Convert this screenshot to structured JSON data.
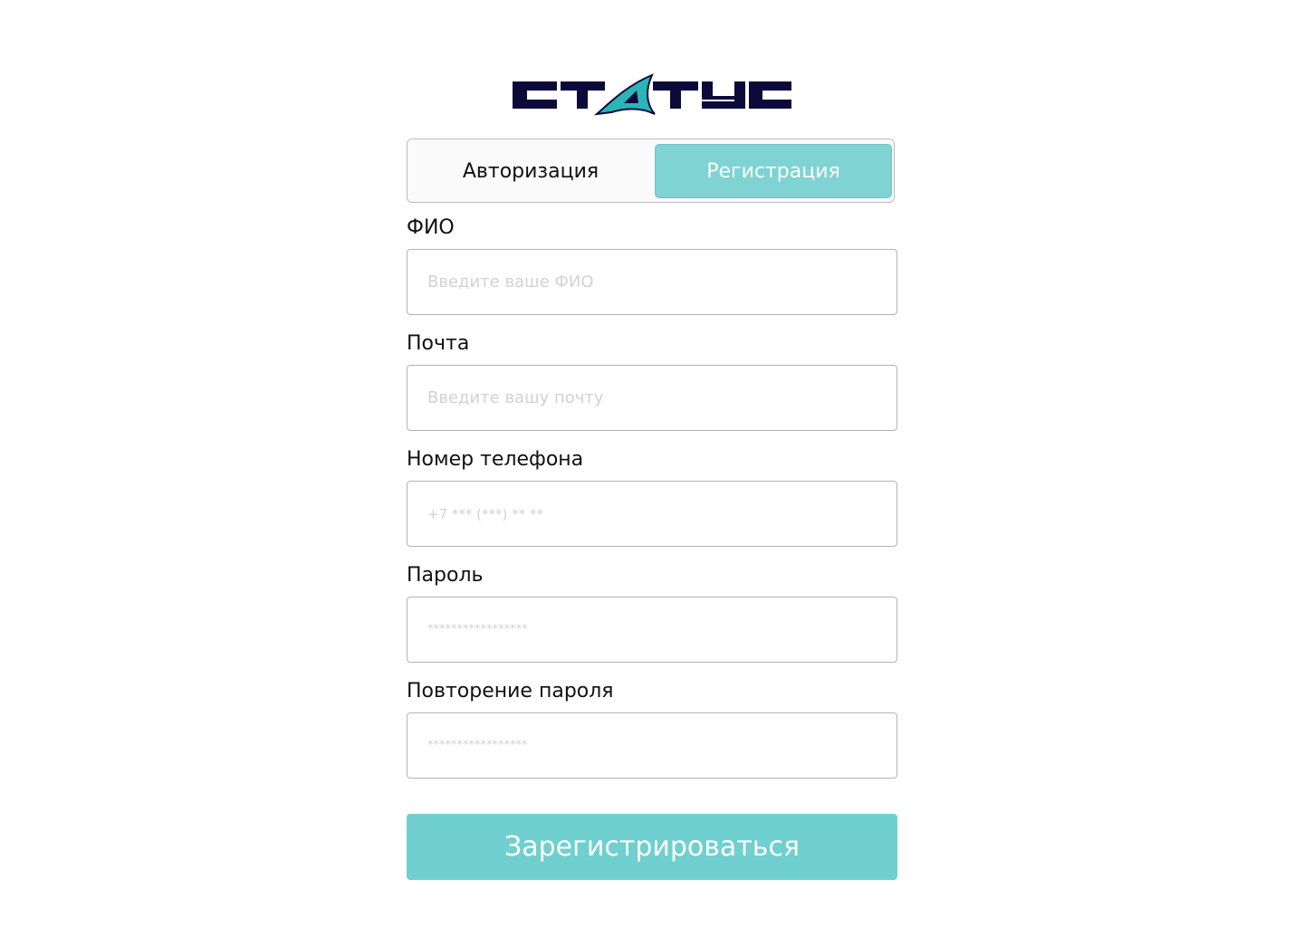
{
  "brand": {
    "logo_text": "СТАТУС",
    "logo_color": "#0b0a3a",
    "accent_color": "#2bb5b8"
  },
  "tabs": {
    "login_label": "Авторизация",
    "register_label": "Регистрация",
    "active": "register"
  },
  "form": {
    "fields": [
      {
        "label": "ФИО",
        "placeholder": "Введите ваше ФИО",
        "value": ""
      },
      {
        "label": "Почта",
        "placeholder": "Введите вашу почту",
        "value": ""
      },
      {
        "label": "Номер телефона",
        "placeholder": "+7 *** (***) ** **",
        "value": ""
      },
      {
        "label": "Пароль",
        "placeholder": "*****************",
        "value": ""
      },
      {
        "label": "Повторение пароля",
        "placeholder": "*****************",
        "value": ""
      }
    ],
    "submit_label": "Зарегистрироваться"
  },
  "colors": {
    "primary": "#6fd0cf",
    "active_tab": "#7fd3d3",
    "input_border": "#b4b4b4"
  }
}
